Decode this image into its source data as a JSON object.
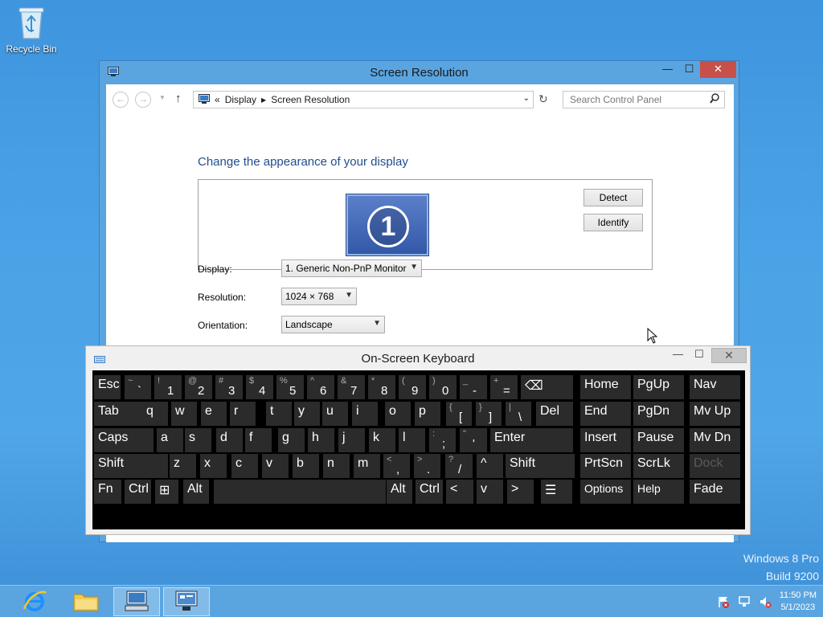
{
  "desktop": {
    "recycle_bin_label": "Recycle Bin"
  },
  "watermark": {
    "line1": "Windows 8 Pro",
    "line2": "Build 9200"
  },
  "taskbar": {
    "clock_time": "11:50 PM",
    "clock_date": "5/1/2023",
    "apps": [
      "internet-explorer",
      "file-explorer",
      "on-screen-keyboard",
      "control-panel"
    ]
  },
  "screen_resolution": {
    "title": "Screen Resolution",
    "breadcrumb": [
      "Display",
      "Screen Resolution"
    ],
    "breadcrumb_prefix": "«",
    "search_placeholder": "Search Control Panel",
    "heading": "Change the appearance of your display",
    "monitor_number": "1",
    "detect_label": "Detect",
    "identify_label": "Identify",
    "display_label": "Display:",
    "display_value": "1. Generic Non-PnP Monitor",
    "resolution_label": "Resolution:",
    "resolution_value": "1024 × 768",
    "orientation_label": "Orientation:",
    "orientation_value": "Landscape"
  },
  "osk": {
    "title": "On-Screen Keyboard",
    "rows": [
      [
        {
          "t": "",
          "b": "Esc"
        },
        {
          "t": "~",
          "b": "`"
        },
        {
          "t": "!",
          "b": "1"
        },
        {
          "t": "@",
          "b": "2"
        },
        {
          "t": "#",
          "b": "3"
        },
        {
          "t": "$",
          "b": "4"
        },
        {
          "t": "%",
          "b": "5"
        },
        {
          "t": "^",
          "b": "6"
        },
        {
          "t": "&",
          "b": "7"
        },
        {
          "t": "*",
          "b": "8"
        },
        {
          "t": "(",
          "b": "9"
        },
        {
          "t": ")",
          "b": "0"
        },
        {
          "t": "_",
          "b": "-"
        },
        {
          "t": "+",
          "b": "="
        },
        {
          "t": "",
          "b": "⌫"
        },
        {
          "t": "",
          "b": "Home"
        },
        {
          "t": "",
          "b": "PgUp"
        },
        {
          "t": "",
          "b": "Nav"
        }
      ],
      [
        {
          "t": "",
          "b": "Tab"
        },
        {
          "t": "",
          "b": "q"
        },
        {
          "t": "",
          "b": "w"
        },
        {
          "t": "",
          "b": "e"
        },
        {
          "t": "",
          "b": "r"
        },
        {
          "t": "",
          "b": "t"
        },
        {
          "t": "",
          "b": "y"
        },
        {
          "t": "",
          "b": "u"
        },
        {
          "t": "",
          "b": "i"
        },
        {
          "t": "",
          "b": "o"
        },
        {
          "t": "",
          "b": "p"
        },
        {
          "t": "{",
          "b": "["
        },
        {
          "t": "}",
          "b": "]"
        },
        {
          "t": "|",
          "b": "\\"
        },
        {
          "t": "",
          "b": "Del"
        },
        {
          "t": "",
          "b": "End"
        },
        {
          "t": "",
          "b": "PgDn"
        },
        {
          "t": "",
          "b": "Mv Up"
        }
      ],
      [
        {
          "t": "",
          "b": "Caps"
        },
        {
          "t": "",
          "b": "a"
        },
        {
          "t": "",
          "b": "s"
        },
        {
          "t": "",
          "b": "d"
        },
        {
          "t": "",
          "b": "f"
        },
        {
          "t": "",
          "b": "g"
        },
        {
          "t": "",
          "b": "h"
        },
        {
          "t": "",
          "b": "j"
        },
        {
          "t": "",
          "b": "k"
        },
        {
          "t": "",
          "b": "l"
        },
        {
          "t": ":",
          "b": ";"
        },
        {
          "t": "\"",
          "b": "'"
        },
        {
          "t": "",
          "b": "Enter"
        },
        {
          "t": "",
          "b": "Insert"
        },
        {
          "t": "",
          "b": "Pause"
        },
        {
          "t": "",
          "b": "Mv Dn"
        }
      ],
      [
        {
          "t": "",
          "b": "Shift"
        },
        {
          "t": "",
          "b": "z"
        },
        {
          "t": "",
          "b": "x"
        },
        {
          "t": "",
          "b": "c"
        },
        {
          "t": "",
          "b": "v"
        },
        {
          "t": "",
          "b": "b"
        },
        {
          "t": "",
          "b": "n"
        },
        {
          "t": "",
          "b": "m"
        },
        {
          "t": "<",
          "b": ","
        },
        {
          "t": ">",
          "b": "."
        },
        {
          "t": "?",
          "b": "/"
        },
        {
          "t": "",
          "b": "^"
        },
        {
          "t": "",
          "b": "Shift"
        },
        {
          "t": "",
          "b": "PrtScn"
        },
        {
          "t": "",
          "b": "ScrLk"
        },
        {
          "t": "",
          "b": "Dock"
        }
      ],
      [
        {
          "t": "",
          "b": "Fn"
        },
        {
          "t": "",
          "b": "Ctrl"
        },
        {
          "t": "",
          "b": "⊞"
        },
        {
          "t": "",
          "b": "Alt"
        },
        {
          "t": "",
          "b": ""
        },
        {
          "t": "",
          "b": "Alt"
        },
        {
          "t": "",
          "b": "Ctrl"
        },
        {
          "t": "",
          "b": "<"
        },
        {
          "t": "",
          "b": "v"
        },
        {
          "t": "",
          "b": ">"
        },
        {
          "t": "",
          "b": "☰"
        },
        {
          "t": "",
          "b": "Options"
        },
        {
          "t": "",
          "b": "Help"
        },
        {
          "t": "",
          "b": "Fade"
        }
      ]
    ]
  }
}
